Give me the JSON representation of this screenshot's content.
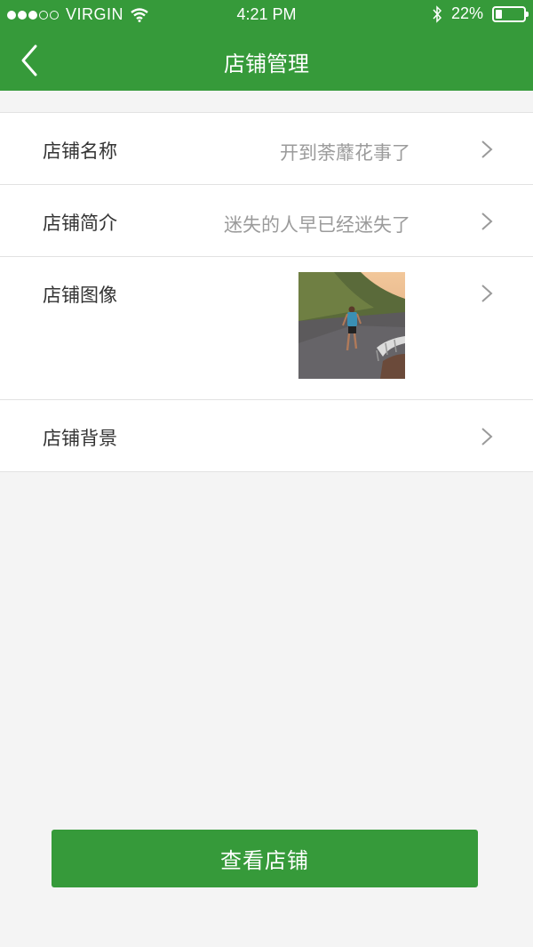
{
  "status": {
    "carrier": "VIRGIN",
    "time": "4:21 PM",
    "battery": "22%",
    "battery_level": 0.22,
    "signal_bars_filled": 3,
    "signal_bars_total": 5
  },
  "nav": {
    "title": "店铺管理"
  },
  "rows": [
    {
      "label": "店铺名称",
      "value": "开到荼蘼花事了"
    },
    {
      "label": "店铺简介",
      "value": "迷失的人早已经迷失了"
    },
    {
      "label": "店铺图像"
    },
    {
      "label": "店铺背景"
    }
  ],
  "cta": {
    "label": "查看店铺"
  },
  "colors": {
    "primary": "#369a3a",
    "background": "#f4f4f4"
  }
}
